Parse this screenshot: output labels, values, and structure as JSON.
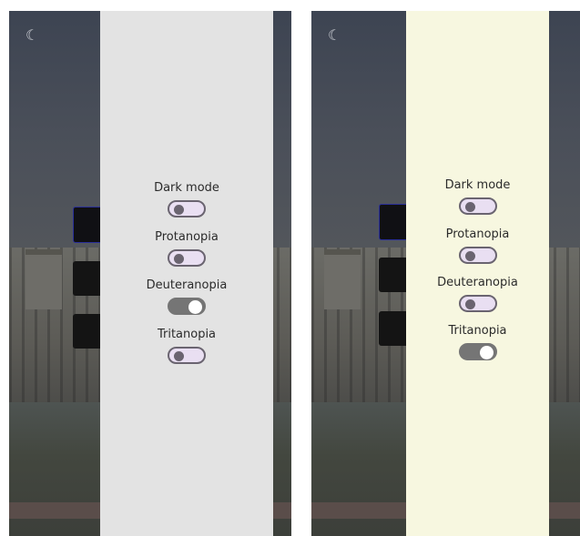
{
  "screens": [
    {
      "id": "left",
      "options": [
        {
          "label": "Dark mode",
          "state": "off"
        },
        {
          "label": "Protanopia",
          "state": "off"
        },
        {
          "label": "Deuteranopia",
          "state": "on"
        },
        {
          "label": "Tritanopia",
          "state": "off"
        }
      ]
    },
    {
      "id": "right",
      "options": [
        {
          "label": "Dark mode",
          "state": "off"
        },
        {
          "label": "Protanopia",
          "state": "off"
        },
        {
          "label": "Deuteranopia",
          "state": "off"
        },
        {
          "label": "Tritanopia",
          "state": "on"
        }
      ]
    }
  ],
  "colors": {
    "left_panel_bg": "#e3e3e3",
    "right_panel_bg": "#f7f7e0",
    "toggle_off_track": "#e9dff2",
    "toggle_on_track": "#757575"
  },
  "icons": {
    "theme_icon": "moon-icon"
  }
}
